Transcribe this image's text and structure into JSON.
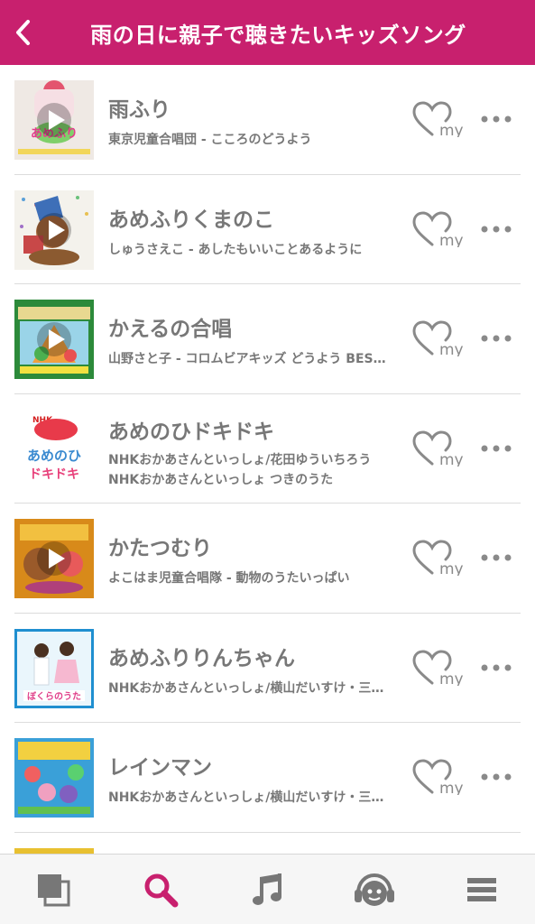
{
  "header": {
    "title": "雨の日に親子で聴きたいキッズソング"
  },
  "colors": {
    "brand": "#c8206e",
    "icon_gray": "#777777",
    "tab_active": "#c8206e"
  },
  "songs": [
    {
      "title": "雨ふり",
      "subtitle": "東京児童合唱団 - こころのどうよう",
      "subtitle2": ""
    },
    {
      "title": "あめふりくまのこ",
      "subtitle": "しゅうさえこ - あしたもいいことあるように",
      "subtitle2": ""
    },
    {
      "title": "かえるの合唱",
      "subtitle": "山野さと子 - コロムビアキッズ どうよう BEST SELECTION",
      "subtitle2": ""
    },
    {
      "title": "あめのひドキドキ",
      "subtitle": "NHKおかあさんといっしょ/花田ゆういちろう",
      "subtitle2": "NHKおかあさんといっしょ つきのうた"
    },
    {
      "title": "かたつむり",
      "subtitle": "よこはま児童合唱隊 - 動物のうたいっぱい",
      "subtitle2": ""
    },
    {
      "title": "あめふりりんちゃん",
      "subtitle": "NHKおかあさんといっしょ/横山だいすけ・三谷たくみ",
      "subtitle2": ""
    },
    {
      "title": "レインマン",
      "subtitle": "NHKおかあさんといっしょ/横山だいすけ・三谷たくみ",
      "subtitle2": ""
    }
  ],
  "album_art": {
    "0": {
      "logo": "NHK"
    },
    "3": {
      "logo": "NHK",
      "art_line1": "あめのひ",
      "art_line2": "ドキドキ"
    },
    "5": {
      "art_label": "ぼくらのうた"
    }
  },
  "tabs": [
    {
      "icon": "library-icon",
      "active": false
    },
    {
      "icon": "search-icon",
      "active": true
    },
    {
      "icon": "music-note-icon",
      "active": false
    },
    {
      "icon": "headphones-icon",
      "active": false
    },
    {
      "icon": "menu-icon",
      "active": false
    }
  ]
}
